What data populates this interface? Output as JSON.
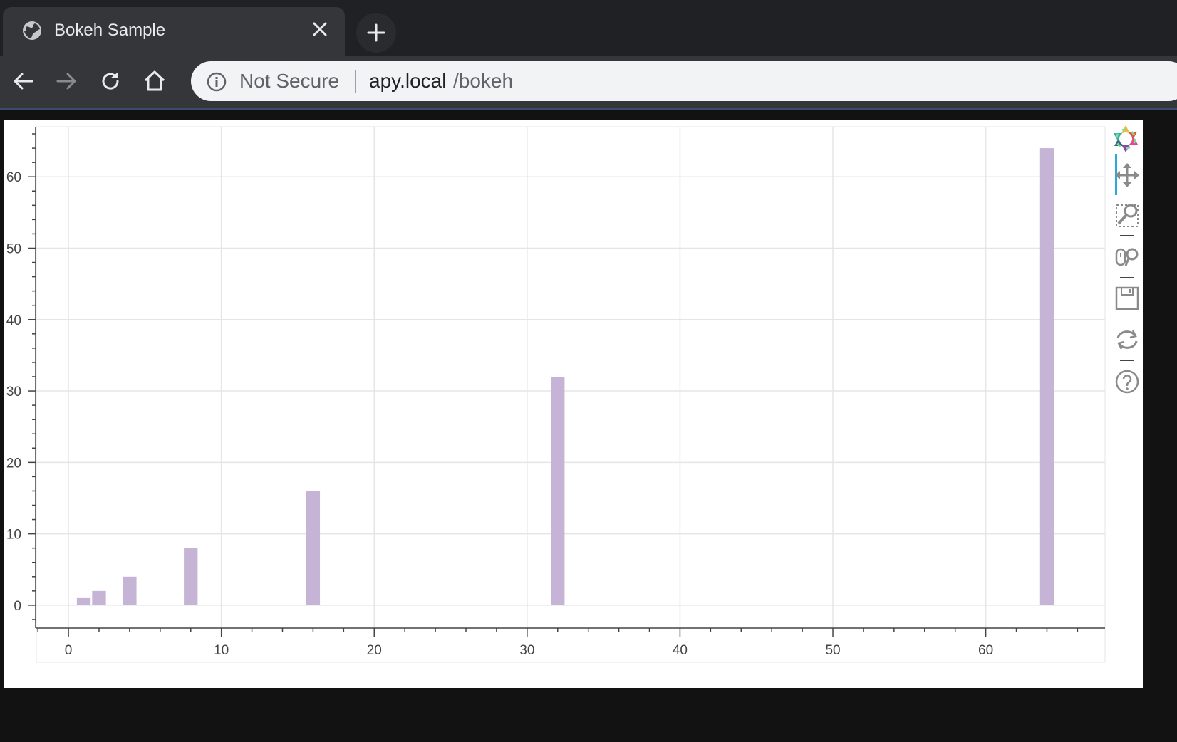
{
  "browser": {
    "tab_title": "Bokeh Sample",
    "address": {
      "security_label": "Not Secure",
      "host": "apy.local",
      "path": "/bokeh"
    },
    "icons": [
      "globe-icon",
      "close-icon",
      "plus-icon",
      "back-arrow-icon",
      "forward-arrow-icon",
      "reload-icon",
      "home-icon",
      "info-icon"
    ]
  },
  "toolbar_icons": [
    "bokeh-logo-icon",
    "pan-icon",
    "box-zoom-icon",
    "wheel-zoom-icon",
    "save-icon",
    "reset-icon",
    "help-icon"
  ],
  "colors": {
    "bar": "#c6b4d6",
    "grid": "#e5e5e5",
    "axis": "#444444",
    "active_tool": "#26aae1"
  },
  "chart_data": {
    "type": "bar",
    "x": [
      1,
      2,
      4,
      8,
      16,
      32,
      64
    ],
    "values": [
      1,
      2,
      4,
      8,
      16,
      32,
      64
    ],
    "bar_width": 0.9,
    "title": "",
    "xlabel": "",
    "ylabel": "",
    "xlim": [
      -2.1,
      67.8
    ],
    "ylim": [
      -3.2,
      67
    ],
    "x_ticks": [
      0,
      10,
      20,
      30,
      40,
      50,
      60
    ],
    "y_ticks": [
      0,
      10,
      20,
      30,
      40,
      50,
      60
    ],
    "grid": true,
    "legend": "none"
  }
}
